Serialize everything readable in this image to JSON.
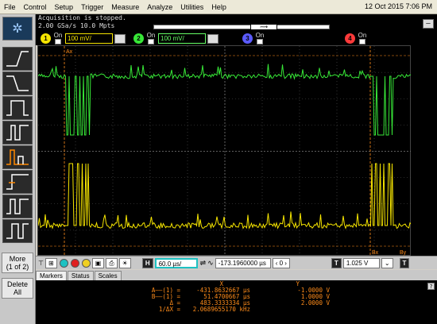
{
  "menu": [
    "File",
    "Control",
    "Setup",
    "Trigger",
    "Measure",
    "Analyze",
    "Utilities",
    "Help"
  ],
  "datetime": "12 Oct 2015  7:06 PM",
  "status": {
    "acq": "Acquisition is stopped.",
    "rate": "2.00 GSa/s   10.0 Mpts"
  },
  "channels": [
    {
      "num": "1",
      "on": "On",
      "scale": "100 mV/",
      "color": "#f5e400"
    },
    {
      "num": "2",
      "on": "On",
      "scale": "100 mV/",
      "color": "#37e637"
    },
    {
      "num": "3",
      "on": "On",
      "scale": "",
      "color": "#5b5bff"
    },
    {
      "num": "4",
      "on": "On",
      "scale": "",
      "color": "#ff3a3a"
    }
  ],
  "sidebar": {
    "more": "More",
    "more_sub": "(1 of 2)",
    "delete": "Delete",
    "delete_sub": "All"
  },
  "controls": {
    "h_label": "H",
    "timebase": "60.0 µs/",
    "delay": "-173.1960000 µs",
    "delay_nav": "0",
    "trig_label": "T",
    "trig_level": "1.025 V",
    "stop_label": "T"
  },
  "tabs": [
    "Markers",
    "Status",
    "Scales"
  ],
  "readout": {
    "header_x": "X",
    "header_y": "Y",
    "rows": [
      {
        "label": "A——(1) =",
        "x": "-431.8632667 µs",
        "y": "-1.0000 V"
      },
      {
        "label": "B——(1) =",
        "x": "51.4700667 µs",
        "y": "1.0000 V"
      },
      {
        "label": "Δ =",
        "x": "483.3333334 µs",
        "y": "2.0000 V"
      },
      {
        "label": "1/ΔX =",
        "x": "2.0689655170 kHz",
        "y": ""
      }
    ]
  },
  "markers": {
    "ax": "Ax",
    "bx": "Bx",
    "ay": "Ay",
    "by": "By"
  },
  "colors": {
    "ch1": "#f5e400",
    "ch2": "#37e637",
    "marker": "#ff8c1a",
    "grid": "#555555"
  }
}
